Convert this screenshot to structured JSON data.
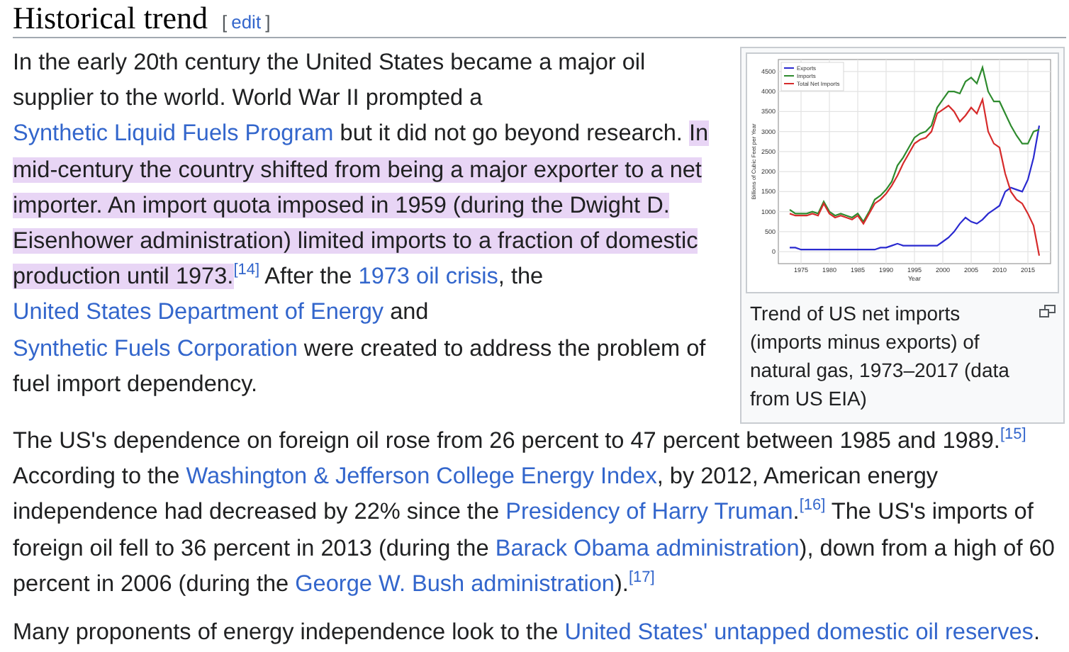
{
  "heading": {
    "title": "Historical trend",
    "edit_open": "[",
    "edit_label": "edit",
    "edit_close": "]"
  },
  "figure": {
    "caption": "Trend of US net imports (imports minus exports) of natural gas, 1973–2017 (data from US EIA)",
    "chart_data": {
      "type": "line",
      "xlabel": "Year",
      "ylabel": "Billions of Cubic Feet per Year",
      "x": [
        1973,
        1974,
        1975,
        1976,
        1977,
        1978,
        1979,
        1980,
        1981,
        1982,
        1983,
        1984,
        1985,
        1986,
        1987,
        1988,
        1989,
        1990,
        1991,
        1992,
        1993,
        1994,
        1995,
        1996,
        1997,
        1998,
        1999,
        2000,
        2001,
        2002,
        2003,
        2004,
        2005,
        2006,
        2007,
        2008,
        2009,
        2010,
        2011,
        2012,
        2013,
        2014,
        2015,
        2016,
        2017
      ],
      "grid": true,
      "legend": true,
      "xlim": [
        1971,
        2019
      ],
      "ylim": [
        -300,
        4800
      ],
      "xticks": [
        1975,
        1980,
        1985,
        1990,
        1995,
        2000,
        2005,
        2010,
        2015
      ],
      "yticks": [
        0,
        500,
        1000,
        1500,
        2000,
        2500,
        3000,
        3500,
        4000,
        4500
      ],
      "series": [
        {
          "name": "Exports",
          "color": "#2a2ad0",
          "values": [
            100,
            100,
            50,
            50,
            50,
            50,
            50,
            50,
            50,
            50,
            50,
            50,
            50,
            50,
            50,
            50,
            100,
            100,
            150,
            200,
            150,
            150,
            150,
            150,
            150,
            150,
            150,
            250,
            350,
            500,
            700,
            850,
            750,
            700,
            800,
            950,
            1050,
            1150,
            1500,
            1600,
            1550,
            1500,
            1800,
            2350,
            3150
          ]
        },
        {
          "name": "Imports",
          "color": "#2e8b2e",
          "values": [
            1050,
            950,
            950,
            950,
            1000,
            950,
            1250,
            1000,
            900,
            950,
            900,
            850,
            950,
            750,
            1000,
            1300,
            1400,
            1550,
            1750,
            2150,
            2350,
            2600,
            2850,
            2950,
            3000,
            3150,
            3600,
            3800,
            4000,
            4000,
            3950,
            4250,
            4350,
            4200,
            4600,
            4000,
            3750,
            3750,
            3450,
            3150,
            2900,
            2700,
            2700,
            3000,
            3050
          ]
        },
        {
          "name": "Total Net Imports",
          "color": "#d62b2b",
          "values": [
            950,
            900,
            900,
            900,
            950,
            900,
            1200,
            950,
            850,
            900,
            850,
            800,
            900,
            700,
            950,
            1200,
            1300,
            1450,
            1650,
            1900,
            2200,
            2450,
            2700,
            2800,
            2850,
            3000,
            3450,
            3550,
            3650,
            3500,
            3250,
            3400,
            3600,
            3450,
            3800,
            3000,
            2700,
            2600,
            1950,
            1500,
            1300,
            1200,
            950,
            650,
            -100
          ]
        }
      ]
    }
  },
  "paragraphs": [
    [
      {
        "kind": "text",
        "text": "In the early 20th century the United States became a major oil supplier to the world. World War II prompted a "
      },
      {
        "kind": "link",
        "text": "Synthetic Liquid Fuels Program"
      },
      {
        "kind": "text",
        "text": " but it did not go beyond research. "
      },
      {
        "kind": "highlight",
        "text": "In mid-century the country shifted from being a major exporter to a net importer. An import quota imposed in 1959 (during the Dwight D. Eisenhower administration) limited imports to a fraction of domestic production until 1973."
      },
      {
        "kind": "ref",
        "text": "[14]"
      },
      {
        "kind": "text",
        "text": " After the "
      },
      {
        "kind": "link",
        "text": "1973 oil crisis"
      },
      {
        "kind": "text",
        "text": ", the "
      },
      {
        "kind": "link",
        "text": "United States Department of Energy"
      },
      {
        "kind": "text",
        "text": " and "
      },
      {
        "kind": "link",
        "text": "Synthetic Fuels Corporation"
      },
      {
        "kind": "text",
        "text": " were created to address the problem of fuel import dependency."
      }
    ],
    [
      {
        "kind": "text",
        "text": "The US's dependence on foreign oil rose from 26 percent to 47 percent between 1985 and 1989."
      },
      {
        "kind": "ref",
        "text": "[15]"
      },
      {
        "kind": "text",
        "text": " According to the "
      },
      {
        "kind": "link",
        "text": "Washington & Jefferson College Energy Index"
      },
      {
        "kind": "text",
        "text": ", by 2012, American energy independence had decreased by 22% since the "
      },
      {
        "kind": "link",
        "text": "Presidency of Harry Truman"
      },
      {
        "kind": "text",
        "text": "."
      },
      {
        "kind": "ref",
        "text": "[16]"
      },
      {
        "kind": "text",
        "text": " The US's imports of foreign oil fell to 36 percent in 2013 (during the "
      },
      {
        "kind": "link",
        "text": "Barack Obama administration"
      },
      {
        "kind": "text",
        "text": "), down from a high of 60 percent in 2006 (during the "
      },
      {
        "kind": "link",
        "text": "George W. Bush administration"
      },
      {
        "kind": "text",
        "text": ")."
      },
      {
        "kind": "ref",
        "text": "[17]"
      }
    ],
    [
      {
        "kind": "text",
        "text": "Many proponents of energy independence look to the "
      },
      {
        "kind": "link",
        "text": "United States' untapped domestic oil reserves"
      },
      {
        "kind": "text",
        "text": "."
      }
    ]
  ]
}
